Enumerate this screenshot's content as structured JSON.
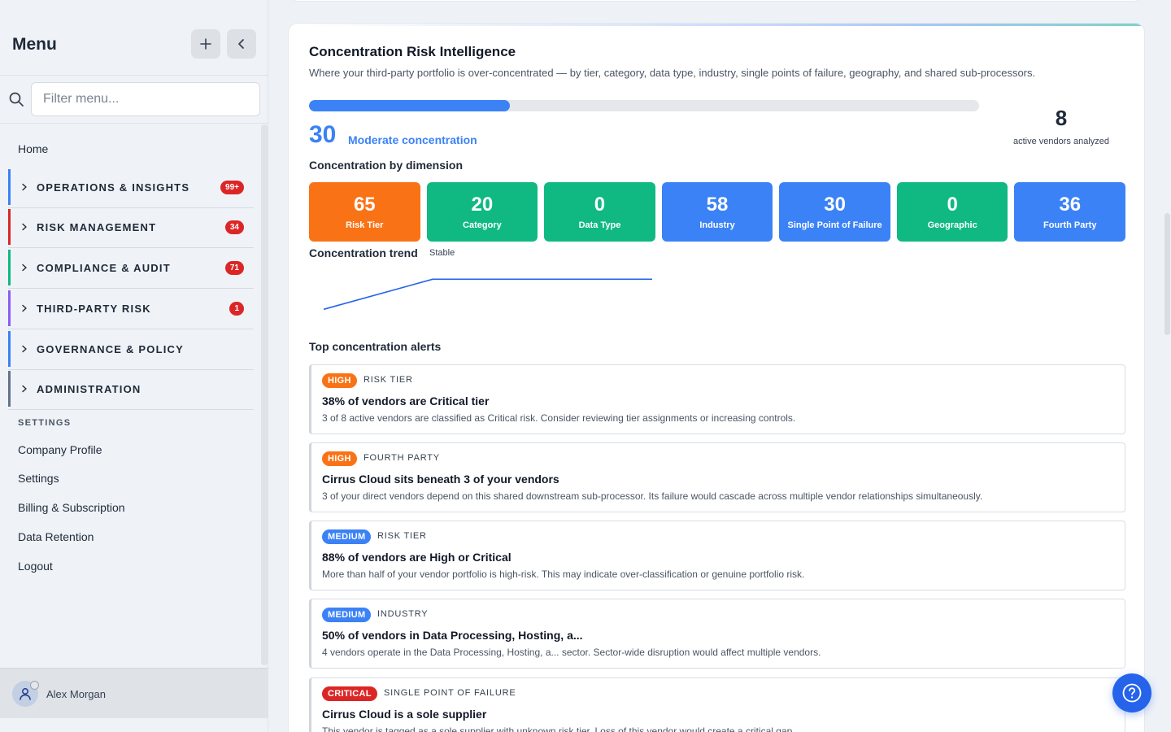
{
  "sidebar": {
    "title": "Menu",
    "filter_placeholder": "Filter menu...",
    "home": "Home",
    "groups": [
      {
        "label": "OPERATIONS & INSIGHTS",
        "badge": "99+",
        "accent": "#3b82f6"
      },
      {
        "label": "RISK MANAGEMENT",
        "badge": "34",
        "accent": "#dc2626"
      },
      {
        "label": "COMPLIANCE & AUDIT",
        "badge": "71",
        "accent": "#10b981"
      },
      {
        "label": "THIRD-PARTY RISK",
        "badge": "1",
        "accent": "#8b5cf6"
      },
      {
        "label": "GOVERNANCE & POLICY",
        "badge": "",
        "accent": "#3b82f6"
      },
      {
        "label": "ADMINISTRATION",
        "badge": "",
        "accent": "#64748b"
      }
    ],
    "settings_label": "SETTINGS",
    "settings_items": [
      "Company Profile",
      "Settings",
      "Billing & Subscription",
      "Data Retention",
      "Logout"
    ],
    "user": {
      "name": "Alex Morgan"
    }
  },
  "card": {
    "title": "Concentration Risk Intelligence",
    "description": "Where your third-party portfolio is over-concentrated — by tier, category, data type, industry, single points of failure, geography, and shared sub-processors.",
    "score": "30",
    "score_fraction": 0.3,
    "score_label": "Moderate concentration",
    "vendor_count": "8",
    "vendor_count_label": "active vendors analyzed",
    "dimension_title": "Concentration by dimension",
    "dimensions": [
      {
        "value": "65",
        "label": "Risk Tier",
        "color": "#f97316"
      },
      {
        "value": "20",
        "label": "Category",
        "color": "#10b981"
      },
      {
        "value": "0",
        "label": "Data Type",
        "color": "#10b981"
      },
      {
        "value": "58",
        "label": "Industry",
        "color": "#3b82f6"
      },
      {
        "value": "30",
        "label": "Single Point of Failure",
        "color": "#3b82f6"
      },
      {
        "value": "0",
        "label": "Geographic",
        "color": "#10b981"
      },
      {
        "value": "36",
        "label": "Fourth Party",
        "color": "#3b82f6"
      }
    ],
    "trend_title": "Concentration trend",
    "trend_state": "Stable",
    "trend": {
      "points": [
        12,
        30,
        30,
        30
      ],
      "color": "#2563eb"
    },
    "alerts_title": "Top concentration alerts",
    "alerts": [
      {
        "severity": "HIGH",
        "severity_color": "#f97316",
        "dimension": "RISK TIER",
        "title": "38% of vendors are Critical tier",
        "description": "3 of 8 active vendors are classified as Critical risk. Consider reviewing tier assignments or increasing controls."
      },
      {
        "severity": "HIGH",
        "severity_color": "#f97316",
        "dimension": "FOURTH PARTY",
        "title": "Cirrus Cloud sits beneath 3 of your vendors",
        "description": "3 of your direct vendors depend on this shared downstream sub-processor. Its failure would cascade across multiple vendor relationships simultaneously."
      },
      {
        "severity": "MEDIUM",
        "severity_color": "#3b82f6",
        "dimension": "RISK TIER",
        "title": "88% of vendors are High or Critical",
        "description": "More than half of your vendor portfolio is high-risk. This may indicate over-classification or genuine portfolio risk."
      },
      {
        "severity": "MEDIUM",
        "severity_color": "#3b82f6",
        "dimension": "INDUSTRY",
        "title": "50% of vendors in Data Processing, Hosting, a...",
        "description": "4 vendors operate in the Data Processing, Hosting, a... sector. Sector-wide disruption would affect multiple vendors."
      },
      {
        "severity": "CRITICAL",
        "severity_color": "#dc2626",
        "dimension": "SINGLE POINT OF FAILURE",
        "title": "Cirrus Cloud is a sole supplier",
        "description": "This vendor is tagged as a sole supplier with unknown risk tier. Loss of this vendor would create a critical gap."
      }
    ]
  },
  "icons": {
    "add": "plus-icon",
    "collapse": "chevron-left-icon",
    "search": "search-icon",
    "group": "chevron-right-icon",
    "user": "user-icon",
    "help": "question-circle-icon"
  }
}
